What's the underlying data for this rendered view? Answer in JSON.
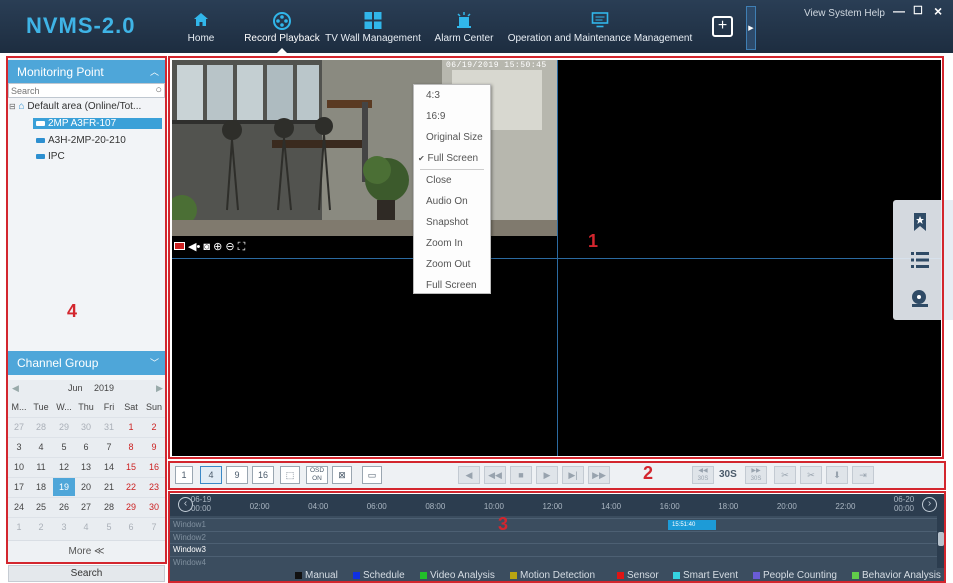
{
  "app": {
    "logo": "NVMS-2.0"
  },
  "nav": [
    {
      "label": "Home",
      "icon": "home-icon"
    },
    {
      "label": "Record Playback",
      "icon": "film-reel-icon",
      "active": true
    },
    {
      "label": "TV Wall Management",
      "icon": "tv-wall-grid-icon"
    },
    {
      "label": "Alarm Center",
      "icon": "alarm-icon"
    },
    {
      "label": "Operation and Maintenance Management",
      "icon": "monitor-icon"
    }
  ],
  "system": {
    "links": "View System Help",
    "minimize": "—",
    "maximize": "☐",
    "close": "×"
  },
  "left": {
    "monitoring_title": "Monitoring Point",
    "search_placeholder": "Search",
    "area": "Default area (Online/Tot...",
    "channels": [
      "2MP A3FR-107",
      "A3H-2MP-20-210",
      "IPC"
    ],
    "channel_group_title": "Channel Group",
    "cal_month": "Jun",
    "cal_year": "2019",
    "weekdays": [
      "M...",
      "Tue",
      "W...",
      "Thu",
      "Fri",
      "Sat",
      "Sun"
    ],
    "days": [
      [
        "27",
        "28",
        "29",
        "30",
        "31",
        "1",
        "2"
      ],
      [
        "3",
        "4",
        "5",
        "6",
        "7",
        "8",
        "9"
      ],
      [
        "10",
        "11",
        "12",
        "13",
        "14",
        "15",
        "16"
      ],
      [
        "17",
        "18",
        "19",
        "20",
        "21",
        "22",
        "23"
      ],
      [
        "24",
        "25",
        "26",
        "27",
        "28",
        "29",
        "30"
      ],
      [
        "1",
        "2",
        "3",
        "4",
        "5",
        "6",
        "7"
      ]
    ],
    "more": "More ≪",
    "search_button": "Search"
  },
  "video": {
    "timestamp": "06/19/2019 15:50:45",
    "context_menu": [
      "4:3",
      "16:9",
      "Original Size",
      "Full Screen",
      "Close",
      "Audio On",
      "Snapshot",
      "Zoom In",
      "Zoom Out",
      "Full Screen"
    ],
    "checked_item": "Full Screen"
  },
  "annotations": {
    "a1": "1",
    "a2": "2",
    "a3": "3",
    "a4": "4"
  },
  "controls": {
    "layouts": [
      "1",
      "4",
      "9",
      "16"
    ],
    "osd": "OSD ON",
    "speed": "30S",
    "back30": "30S",
    "fwd30": "30S"
  },
  "timeline": {
    "start_date": "06-19",
    "end_date": "06-20",
    "ticks": [
      "00:00",
      "02:00",
      "04:00",
      "06:00",
      "08:00",
      "10:00",
      "12:00",
      "14:00",
      "16:00",
      "18:00",
      "20:00",
      "22:00",
      "00:00"
    ],
    "windows": [
      "Window1",
      "Window2",
      "Window3",
      "Window4"
    ],
    "segment_label": "15:51:40"
  },
  "legend": [
    {
      "label": "Manual",
      "color": "#111111"
    },
    {
      "label": "Schedule",
      "color": "#1030e0"
    },
    {
      "label": "Video Analysis",
      "color": "#22c02a"
    },
    {
      "label": "Motion Detection",
      "color": "#b9a412"
    },
    {
      "label": "Sensor",
      "color": "#e01515"
    },
    {
      "label": "Smart Event",
      "color": "#35d4e0"
    },
    {
      "label": "People Counting",
      "color": "#6a5cd6"
    },
    {
      "label": "Behavior Analysis",
      "color": "#62cc4a"
    }
  ]
}
